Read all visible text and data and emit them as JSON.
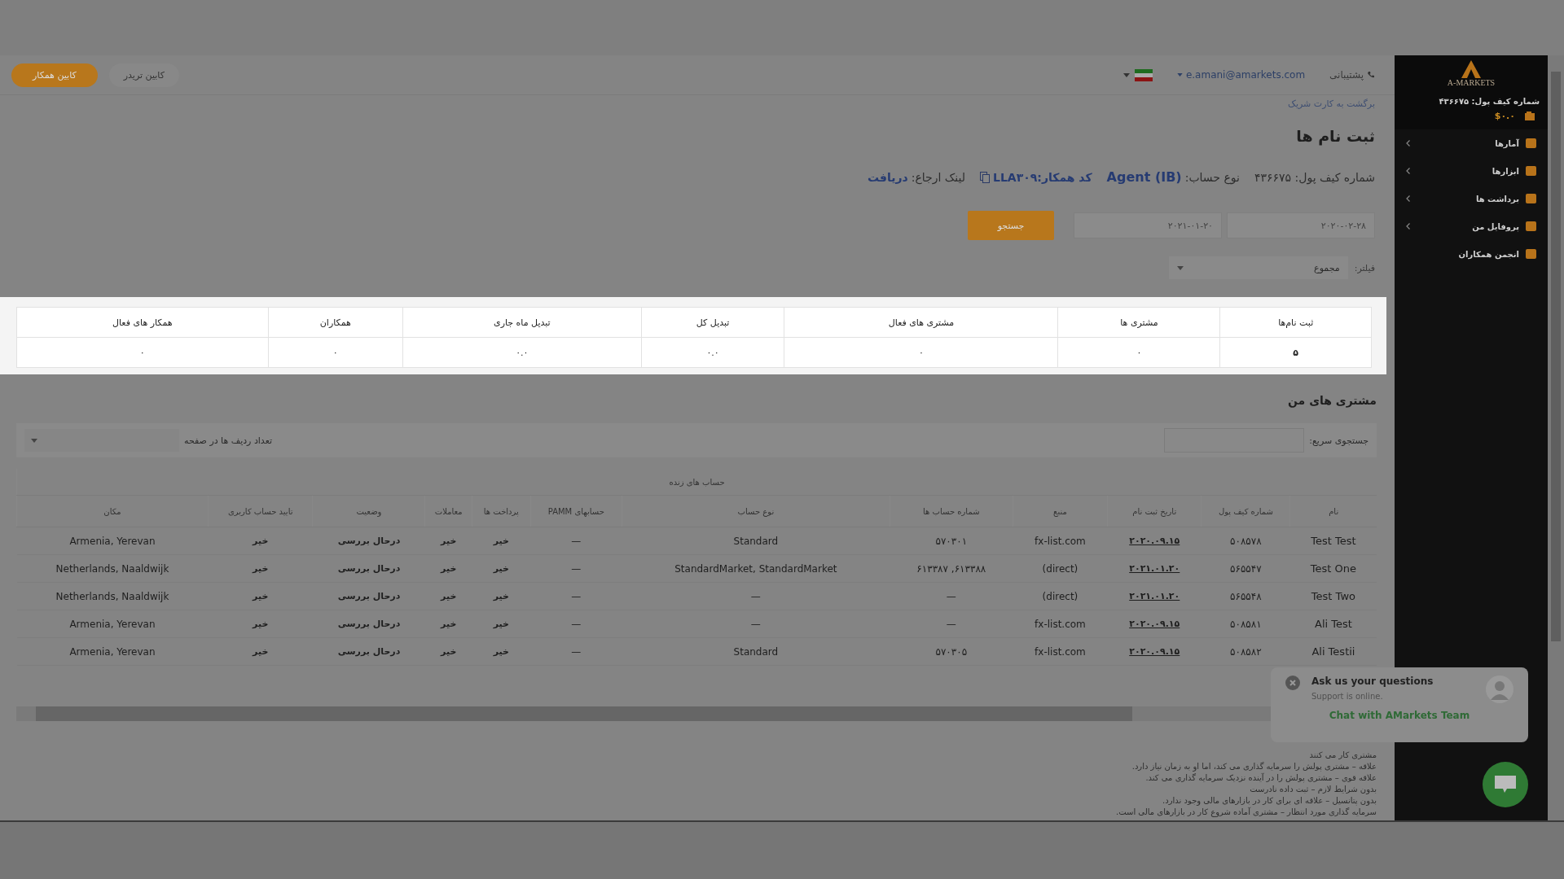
{
  "header": {
    "cabins": [
      {
        "label": "کابین تریدر",
        "selected": false
      },
      {
        "label": "کابین همکار",
        "selected": true
      }
    ],
    "support": "پشتیبانی",
    "email": "e.amani@amarkets.com"
  },
  "breadcrumb": "برگشت به کارت شریک",
  "title": "ثبت نام ها",
  "info": {
    "wallet_label": "شماره کیف پول:",
    "wallet": "۴۳۶۶۷۵",
    "account_type_label": "نوع حساب:",
    "account_type": "Agent (IB)",
    "partner_code_label": "کد همکار:",
    "partner_code": "LLA۳۰۹",
    "referral_label": "لینک ارجاع:",
    "referral_link": "دریافت"
  },
  "date_from": "۲۰۲۰-۰۲-۲۸",
  "date_to": "۲۰۲۱-۰۱-۲۰",
  "search_button": "جستجو",
  "filter": {
    "label": "فیلتر:",
    "value": "مجموع"
  },
  "stats": [
    {
      "label": "ثبت نام‌ها",
      "value": "۵"
    },
    {
      "label": "مشتری ها",
      "value": "۰"
    },
    {
      "label": "مشتری های فعال",
      "value": "۰"
    },
    {
      "label": "تبدیل کل",
      "value": "۰.۰"
    },
    {
      "label": "تبدیل ماه جاری",
      "value": "۰.۰"
    },
    {
      "label": "همکاران",
      "value": "۰"
    },
    {
      "label": "همکار های فعال",
      "value": "۰"
    }
  ],
  "clients": {
    "title": "مشتری های من",
    "quick_search_label": "جستجوی سریع:",
    "rows_per_page_label": "تعداد ردیف ها در صفحه",
    "group_header": "حساب های زنده",
    "columns": [
      {
        "label": "نام",
        "kind": "text"
      },
      {
        "label": "شماره کیف پول",
        "kind": "text"
      },
      {
        "label": "تاریخ ثبت نام",
        "kind": "link"
      },
      {
        "label": "منبع",
        "kind": "text"
      },
      {
        "label": "شماره حساب ها",
        "kind": "text"
      },
      {
        "label": "نوع حساب",
        "kind": "text"
      },
      {
        "label": "حسابهای PAMM",
        "kind": "text"
      },
      {
        "label": "پرداخت ها",
        "kind": "text"
      },
      {
        "label": "معاملات",
        "kind": "text"
      },
      {
        "label": "وضعیت",
        "kind": "text"
      },
      {
        "label": "تایید حساب کاربری",
        "kind": "text"
      },
      {
        "label": "مکان",
        "kind": "text"
      }
    ],
    "rows": [
      [
        "Test Test",
        "۵۰۸۵۷۸",
        "۲۰۲۰.۰۹.۱۵",
        "fx-list.com",
        "۵۷۰۳۰۱",
        "Standard",
        "—",
        "خیر",
        "خیر",
        "درحال بررسی",
        "خیر",
        "Armenia, Yerevan"
      ],
      [
        "Test One",
        "۵۶۵۵۴۷",
        "۲۰۲۱.۰۱.۲۰",
        "(direct)",
        "۶۱۳۳۸۸, ۶۱۳۳۸۷",
        "StandardMarket, StandardMarket",
        "—",
        "خیر",
        "خیر",
        "درحال بررسی",
        "خیر",
        "Netherlands, Naaldwijk"
      ],
      [
        "Test Two",
        "۵۶۵۵۴۸",
        "۲۰۲۱.۰۱.۲۰",
        "(direct)",
        "—",
        "—",
        "—",
        "خیر",
        "خیر",
        "درحال بررسی",
        "خیر",
        "Netherlands, Naaldwijk"
      ],
      [
        "Ali Test",
        "۵۰۸۵۸۱",
        "۲۰۲۰.۰۹.۱۵",
        "fx-list.com",
        "—",
        "—",
        "—",
        "خیر",
        "خیر",
        "درحال بررسی",
        "خیر",
        "Armenia, Yerevan"
      ],
      [
        "Ali Testii",
        "۵۰۸۵۸۲",
        "۲۰۲۰.۰۹.۱۵",
        "fx-list.com",
        "۵۷۰۳۰۵",
        "Standard",
        "—",
        "خیر",
        "خیر",
        "درحال بررسی",
        "خیر",
        "Armenia, Yerevan"
      ]
    ]
  },
  "legend": [
    "مشتری کار می کنند",
    "علاقه – مشتری پولش را سرمایه گذاری می کند، اما او به زمان نیاز دارد.",
    "علاقه قوی – مشتری پولش را در آینده نزدیک سرمایه گذاری می کند.",
    "بدون شرایط لازم – ثبت داده نادرست",
    "بدون پتانسیل – علاقه ای برای کار در بازارهای مالی وجود ندارد.",
    "سرمایه گذاری مورد انتظار – مشتری آماده شروع کار در بازارهای مالی است."
  ],
  "sidebar": {
    "logo": "A-MARKETS",
    "wallet": "شماره کیف پول: ۴۳۶۶۷۵",
    "balance": "$۰.۰",
    "items": [
      {
        "label": "آمارها",
        "kind": "expandable"
      },
      {
        "label": "ابزارها",
        "kind": "expandable"
      },
      {
        "label": "برداشت ها",
        "kind": "expandable"
      },
      {
        "label": "پروفایل من",
        "kind": "expandable"
      },
      {
        "label": "انجمن همکاران",
        "kind": "plain"
      }
    ]
  },
  "chat": {
    "title": "Ask us your questions",
    "status": "Support is online.",
    "action": "Chat with AMarkets Team"
  }
}
